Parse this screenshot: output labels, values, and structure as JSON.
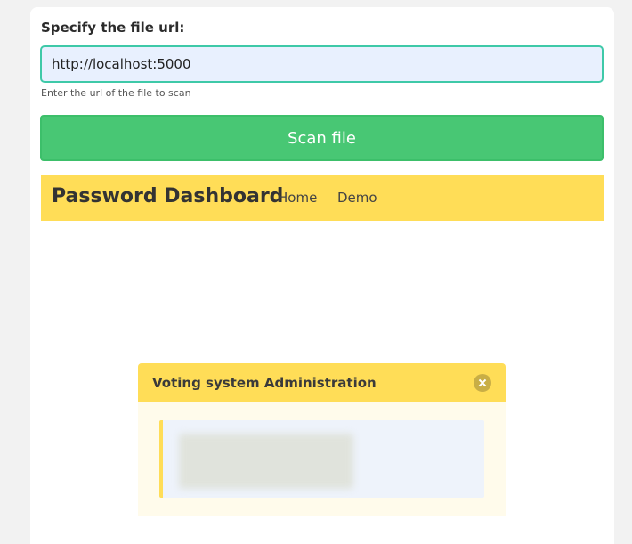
{
  "form": {
    "label": "Specify the file url:",
    "input_value": "http://localhost:5000",
    "help_text": "Enter the url of the file to scan",
    "scan_button_label": "Scan file"
  },
  "preview": {
    "navbar": {
      "brand": "Password Dashboard",
      "items": [
        {
          "label": "Home"
        },
        {
          "label": "Demo"
        }
      ]
    },
    "modal": {
      "title": "Voting system Administration",
      "close_icon": "close-icon"
    }
  },
  "colors": {
    "accent_green": "#48c774",
    "input_border": "#3ec9a8",
    "warning_yellow": "#ffdd57",
    "modal_body": "#fffbeb"
  }
}
